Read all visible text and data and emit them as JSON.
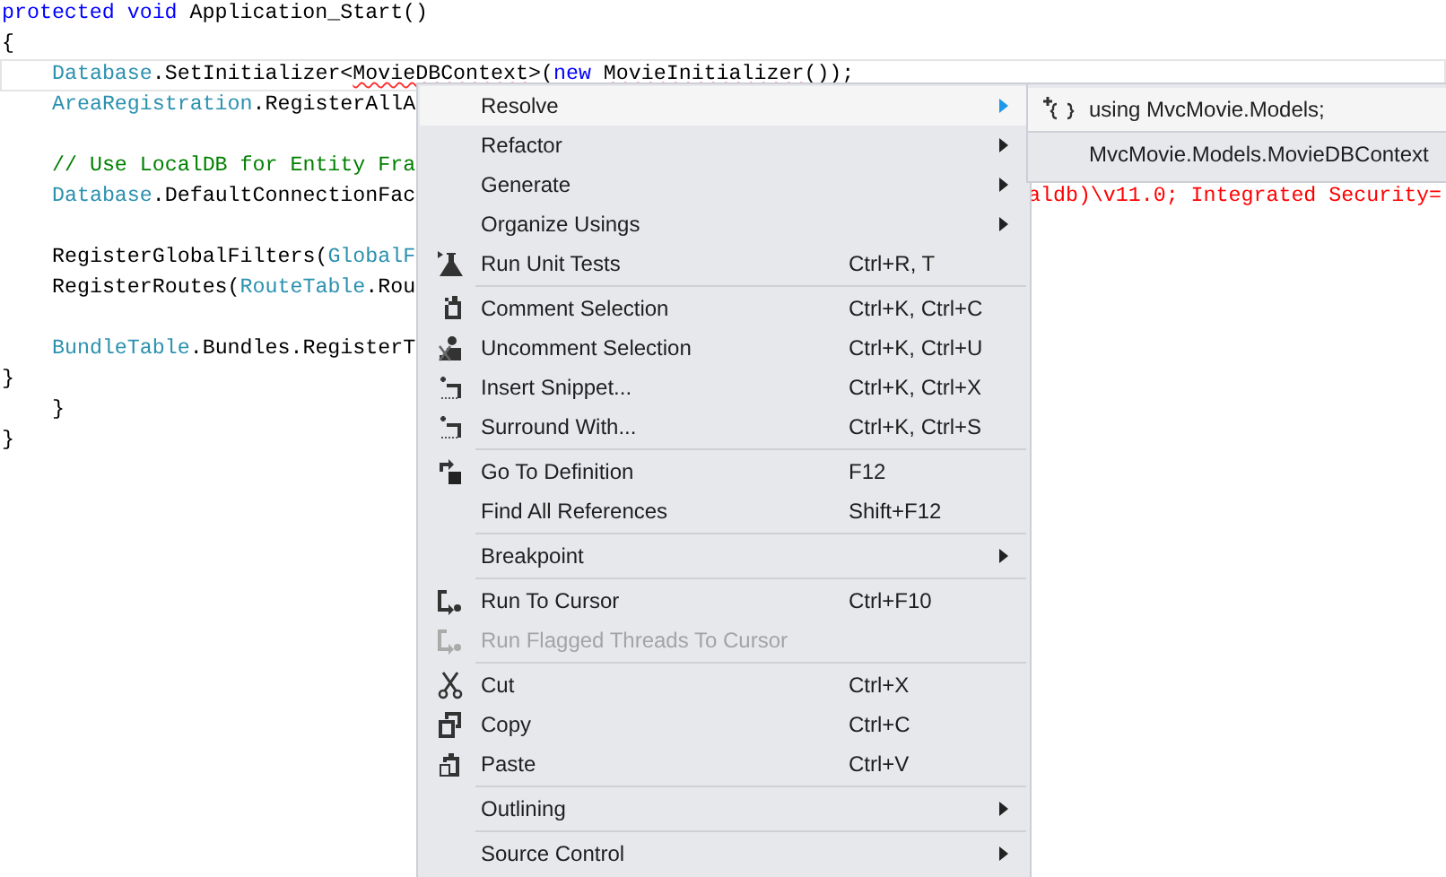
{
  "editor": {
    "lines": [
      {
        "current": false,
        "indented": false,
        "segments": [
          {
            "kind": "kw",
            "text": "protected void"
          },
          {
            "kind": "plain",
            "text": " Application_Start()"
          }
        ]
      },
      {
        "current": false,
        "indented": false,
        "segments": [
          {
            "kind": "plain",
            "text": "{"
          }
        ]
      },
      {
        "current": true,
        "indented": true,
        "segments": [
          {
            "kind": "type",
            "text": "Database"
          },
          {
            "kind": "plain",
            "text": ".SetInitializer<"
          },
          {
            "kind": "error",
            "text": "MovieDBContext"
          },
          {
            "kind": "plain",
            "text": ">("
          },
          {
            "kind": "kw",
            "text": "new "
          },
          {
            "kind": "error",
            "text": "MovieInitializer"
          },
          {
            "kind": "plain",
            "text": "());"
          }
        ]
      },
      {
        "current": false,
        "indented": true,
        "segments": [
          {
            "kind": "type",
            "text": "AreaRegistration"
          },
          {
            "kind": "plain",
            "text": ".RegisterAllA"
          }
        ]
      },
      {
        "current": false
      },
      {
        "current": false,
        "indented": true,
        "segments": [
          {
            "kind": "comment",
            "text": "// Use LocalDB for Entity Fra"
          }
        ]
      },
      {
        "current": false,
        "indented": true,
        "segments": [
          {
            "kind": "type",
            "text": "Database"
          },
          {
            "kind": "plain",
            "text": ".DefaultConnectionFac"
          }
        ],
        "tail": "aldb)\\v11.0; Integrated Security="
      },
      {
        "current": false
      },
      {
        "current": false,
        "indented": true,
        "segments": [
          {
            "kind": "plain",
            "text": "RegisterGlobalFilters("
          },
          {
            "kind": "type",
            "text": "GlobalF"
          }
        ]
      },
      {
        "current": false,
        "indented": true,
        "segments": [
          {
            "kind": "plain",
            "text": "RegisterRoutes("
          },
          {
            "kind": "type",
            "text": "RouteTable"
          },
          {
            "kind": "plain",
            "text": ".Rou"
          }
        ]
      },
      {
        "current": false
      },
      {
        "current": false,
        "indented": true,
        "segments": [
          {
            "kind": "type",
            "text": "BundleTable"
          },
          {
            "kind": "plain",
            "text": ".Bundles.RegisterT"
          }
        ]
      },
      {
        "current": false,
        "indented": false,
        "segments": [
          {
            "kind": "plain",
            "text": "}"
          }
        ]
      },
      {
        "current": false,
        "indented": true,
        "segments": [
          {
            "kind": "plain",
            "text": "}"
          }
        ]
      },
      {
        "current": false,
        "indented": false,
        "segments": [
          {
            "kind": "plain",
            "text": "}"
          }
        ]
      }
    ]
  },
  "context_menu": {
    "groups": [
      [
        {
          "label": "Resolve",
          "submenu": true,
          "disabled": false,
          "selected": true
        },
        {
          "label": "Refactor",
          "submenu": true,
          "disabled": false,
          "selected": false
        },
        {
          "label": "Generate",
          "submenu": true,
          "disabled": false,
          "selected": false
        },
        {
          "label": "Organize Usings",
          "submenu": true,
          "disabled": false,
          "selected": false
        },
        {
          "label": "Run Unit Tests",
          "shortcut": "Ctrl+R, T",
          "submenu": false,
          "disabled": false,
          "selected": false
        }
      ],
      [
        {
          "label": "Comment Selection",
          "shortcut": "Ctrl+K, Ctrl+C",
          "submenu": false,
          "disabled": false,
          "selected": false
        },
        {
          "label": "Uncomment Selection",
          "shortcut": "Ctrl+K, Ctrl+U",
          "submenu": false,
          "disabled": false,
          "selected": false
        },
        {
          "label": "Insert Snippet...",
          "shortcut": "Ctrl+K, Ctrl+X",
          "submenu": false,
          "disabled": false,
          "selected": false
        },
        {
          "label": "Surround With...",
          "shortcut": "Ctrl+K, Ctrl+S",
          "submenu": false,
          "disabled": false,
          "selected": false
        }
      ],
      [
        {
          "label": "Go To Definition",
          "shortcut": "F12",
          "submenu": false,
          "disabled": false,
          "selected": false
        },
        {
          "label": "Find All References",
          "shortcut": "Shift+F12",
          "submenu": false,
          "disabled": false,
          "selected": false
        }
      ],
      [
        {
          "label": "Breakpoint",
          "submenu": true,
          "disabled": false,
          "selected": false
        }
      ],
      [
        {
          "label": "Run To Cursor",
          "shortcut": "Ctrl+F10",
          "submenu": false,
          "disabled": false,
          "selected": false
        },
        {
          "label": "Run Flagged Threads To Cursor",
          "submenu": false,
          "disabled": true,
          "selected": false
        }
      ],
      [
        {
          "label": "Cut",
          "shortcut": "Ctrl+X",
          "submenu": false,
          "disabled": false,
          "selected": false
        },
        {
          "label": "Copy",
          "shortcut": "Ctrl+C",
          "submenu": false,
          "disabled": false,
          "selected": false
        },
        {
          "label": "Paste",
          "shortcut": "Ctrl+V",
          "submenu": false,
          "disabled": false,
          "selected": false
        }
      ],
      [
        {
          "label": "Outlining",
          "submenu": true,
          "disabled": false,
          "selected": false
        }
      ],
      [
        {
          "label": "Source Control",
          "submenu": true,
          "disabled": false,
          "selected": false
        }
      ]
    ]
  },
  "resolve_submenu": {
    "items": [
      {
        "label": "using MvcMovie.Models;",
        "selected": true
      },
      {
        "label": "MvcMovie.Models.MovieDBContext",
        "selected": false
      }
    ]
  }
}
